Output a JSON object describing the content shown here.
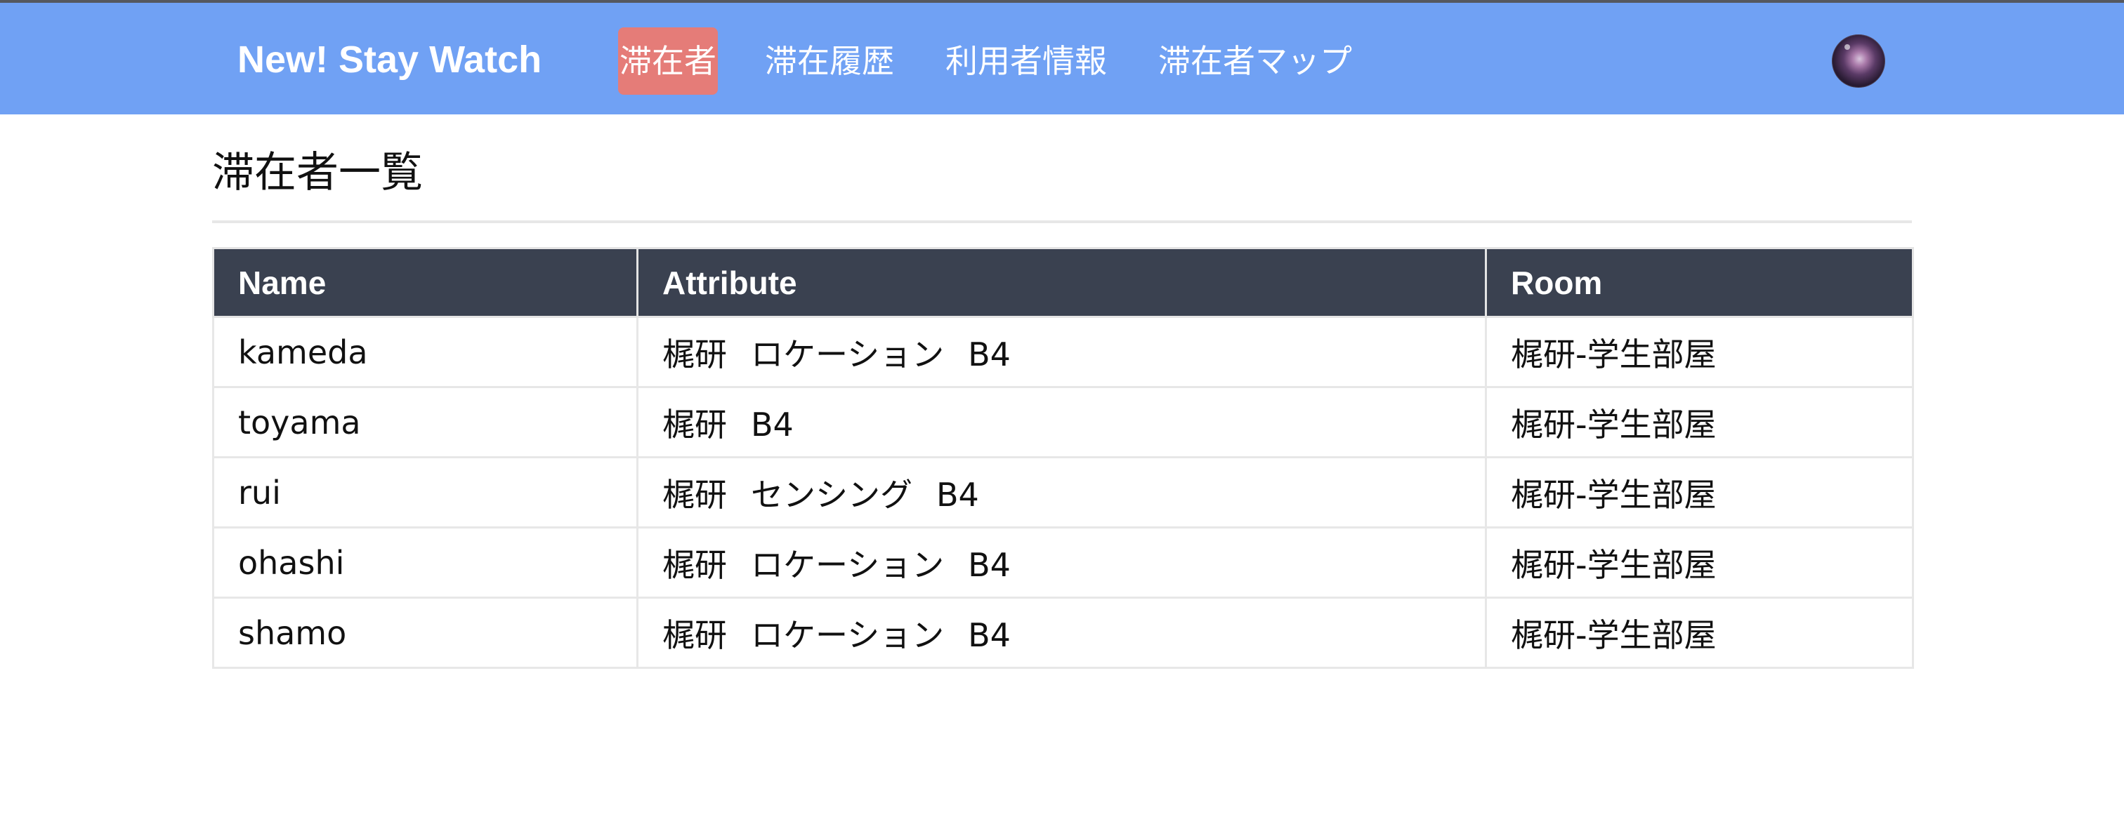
{
  "header": {
    "brand": "New! Stay Watch",
    "nav": [
      {
        "label": "滞在者",
        "active": true
      },
      {
        "label": "滞在履歴",
        "active": false
      },
      {
        "label": "利用者情報",
        "active": false
      },
      {
        "label": "滞在者マップ",
        "active": false
      }
    ],
    "avatar_icon": "user-avatar-icon",
    "colors": {
      "bar": "#70a1f4",
      "active_tab": "#e57c78"
    }
  },
  "main": {
    "title": "滞在者一覧",
    "table": {
      "columns": [
        "Name",
        "Attribute",
        "Room"
      ],
      "header_color": "#3a4150",
      "rows": [
        {
          "name": "kameda",
          "attributes": [
            "梶研",
            "ロケーション",
            "B4"
          ],
          "room": "梶研-学生部屋"
        },
        {
          "name": "toyama",
          "attributes": [
            "梶研",
            "B4"
          ],
          "room": "梶研-学生部屋"
        },
        {
          "name": "rui",
          "attributes": [
            "梶研",
            "センシング",
            "B4"
          ],
          "room": "梶研-学生部屋"
        },
        {
          "name": "ohashi",
          "attributes": [
            "梶研",
            "ロケーション",
            "B4"
          ],
          "room": "梶研-学生部屋"
        },
        {
          "name": "shamo",
          "attributes": [
            "梶研",
            "ロケーション",
            "B4"
          ],
          "room": "梶研-学生部屋"
        }
      ]
    }
  }
}
